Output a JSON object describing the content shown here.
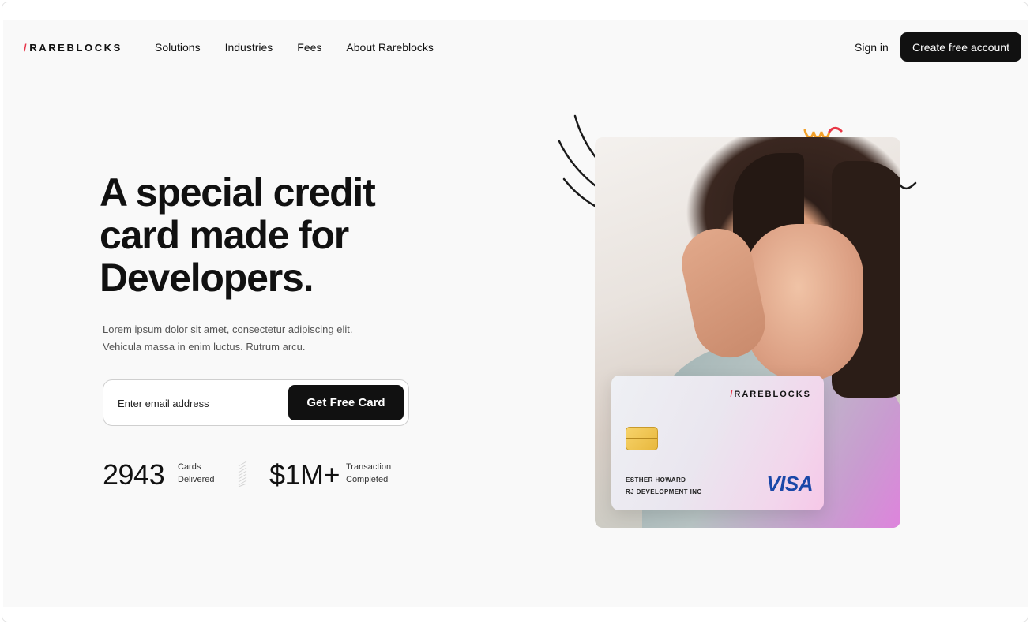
{
  "brand": {
    "slash": "/",
    "name": "RAREBLOCKS",
    "accent": "#e8364a"
  },
  "nav": {
    "items": [
      {
        "label": "Solutions"
      },
      {
        "label": "Industries"
      },
      {
        "label": "Fees"
      },
      {
        "label": "About Rareblocks"
      }
    ],
    "sign_in": "Sign in",
    "cta": "Create free account"
  },
  "hero": {
    "headline_line1": "A special credit",
    "headline_line2": "card made for",
    "headline_line3": "Developers.",
    "description_line1": "Lorem ipsum dolor sit amet, consectetur adipiscing elit.",
    "description_line2": "Vehicula massa in enim luctus. Rutrum arcu.",
    "email_placeholder": "Enter email address",
    "submit_label": "Get Free Card"
  },
  "stats": [
    {
      "value": "2943",
      "label_line1": "Cards",
      "label_line2": "Delivered"
    },
    {
      "value": "$1M+",
      "label_line1": "Transaction",
      "label_line2": "Completed"
    }
  ],
  "card": {
    "slash": "/",
    "brand": "RAREBLOCKS",
    "holder": "ESTHER HOWARD",
    "company": "RJ DEVELOPMENT INC",
    "network": "VISA"
  },
  "icons": {
    "chip": "card-chip-icon",
    "lines": "swoosh-lines-decoration",
    "squiggle": "squiggle-decoration",
    "tilde": "tilde-decoration"
  }
}
